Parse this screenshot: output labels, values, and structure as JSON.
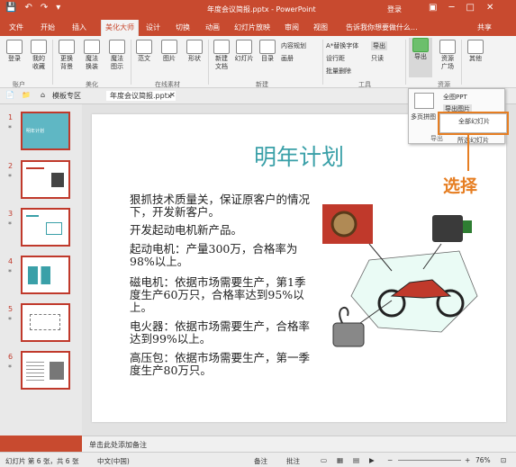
{
  "app": {
    "title": "年度会议简报.pptx - PowerPoint",
    "login": "登录",
    "share": "共享"
  },
  "tabs": [
    {
      "label": "文件"
    },
    {
      "label": "开始"
    },
    {
      "label": "插入"
    },
    {
      "label": "美化大师"
    },
    {
      "label": "设计"
    },
    {
      "label": "切换"
    },
    {
      "label": "动画"
    },
    {
      "label": "幻灯片放映"
    },
    {
      "label": "审阅"
    },
    {
      "label": "视图"
    },
    {
      "label": "告诉我你想要做什么..."
    }
  ],
  "ribbon": {
    "buttons": [
      {
        "label": "登录"
      },
      {
        "label": "我的\n收藏"
      },
      {
        "label": "更换\n背景"
      },
      {
        "label": "魔法\n换装"
      },
      {
        "label": "魔法\n图示"
      },
      {
        "label": "范文"
      },
      {
        "label": "图片"
      },
      {
        "label": "形状"
      },
      {
        "label": "新建\n文档"
      },
      {
        "label": "幻灯片"
      },
      {
        "label": "目录"
      },
      {
        "label": "导出"
      },
      {
        "label": "资源\n广场"
      },
      {
        "label": "其他"
      }
    ],
    "small": {
      "content_plan": "内容规划",
      "header": "画册",
      "replace_font": "A*替换字体",
      "export_small": "导出",
      "set_line_spacing": "设行距",
      "text": "只读",
      "batch_delete": "批量删除"
    },
    "groups": {
      "account": "账户",
      "beautify": "美化",
      "online_material": "在线素材",
      "new": "新建",
      "tools": "工具",
      "resources": "资源"
    }
  },
  "doc_tabs": {
    "profile": "模板专区",
    "file": "年度会议简报.pptx"
  },
  "dropdown": {
    "multi_export": "多页拼图",
    "items": [
      "全图PPT",
      "导出图片",
      "全部幻灯片",
      "所选幻灯片"
    ],
    "section": "导出"
  },
  "callout": "选择",
  "thumbnails": [
    {
      "num": "1",
      "title": "明年计划"
    },
    {
      "num": "2"
    },
    {
      "num": "3"
    },
    {
      "num": "4"
    },
    {
      "num": "5"
    },
    {
      "num": "6"
    }
  ],
  "slide": {
    "title": "明年计划",
    "paragraphs": [
      "狠抓技术质量关，保证原客户的情况下，开发新客户。",
      "开发起动电机新产品。",
      "起动电机：产量300万，合格率为98%以上。",
      "磁电机：依据市场需要生产，第1季度生产60万只，合格率达到95%以上。",
      "电火器：依据市场需要生产，合格率达到99%以上。",
      "高压包：依据市场需要生产，第一季度生产80万只。"
    ]
  },
  "notes": "单击此处添加备注",
  "status": {
    "slide_info": "幻灯片 第 6 张，共 6 张",
    "lang": "中文(中国)",
    "notes": "备注",
    "comments": "批注",
    "zoom": "76%"
  },
  "colors": {
    "accent": "#c84a2f",
    "callout": "#e67e22",
    "title_teal": "#3aa0a8"
  }
}
